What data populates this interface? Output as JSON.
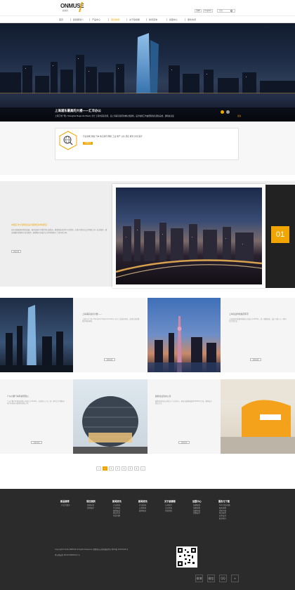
{
  "header": {
    "logo": "ONMUSE",
    "logo_sub": "欧穆斯",
    "lang_cn": "简体",
    "lang_en": "English",
    "search_placeholder": "搜索"
  },
  "nav": [
    "首页",
    "欧穆斯简介",
    "产品中心",
    "项目案例",
    "关于欧穆斯",
    "新闻咨询",
    "加盟中心",
    "服务支持"
  ],
  "nav_active_index": 3,
  "hero": {
    "title": "上海浦东最高的大楼——汇丰办公",
    "text": "上海汇丰广场 / Shanghai Magnolia Plaza | 位于上海市浦东新区，是上海浦东新区的地标性建筑，设计和施工均由国际知名团队完成，建筑总高度",
    "more": "更多"
  },
  "industry": {
    "text": "行业领域 金融 汽车 电子通讯 网络 工业 地产 公共 酒店 教育 文化 医疗",
    "button": "查看更多"
  },
  "feature": {
    "title": "中国汇丰大厦项目设计装修及材料研究",
    "desc": "近年来随着国内经济发展，国内高端写字楼需求日益增长，欧穆斯依托多年行业经验，为客户提供从设计到施工的一站式服务。通过精细化管理和专业化服务，欧穆斯在高端办公空间领域树立了良好的口碑。",
    "button": "查看详情",
    "number": "01"
  },
  "cards": [
    {
      "title": "上海浦东最高大楼——",
      "desc": "上海汇丰广场 | Shanghai Magnolia Plaza | 位于上海浦东新区，是浦东新区重要的地标建筑。",
      "button": "查看详情"
    },
    {
      "title": "上海创业科技集团写字",
      "desc": "上海创业科技集团有限公司成立于2003年，是一家集研发、设计与施工于一体的综合性企业。",
      "button": "查看详情"
    },
    {
      "title": "广州小鹏汽车科技有限公",
      "desc": "广州小鹏汽车科技有限公司成立于2014年，总部位于广州，是一家专注于智能电动汽车研发与制造的科技公司。",
      "button": "查看详情"
    },
    {
      "title": "越秀商业新办公室",
      "desc": "越秀商业新办公室位于广州市中心，项目总建筑面积约20000平方米，整体设计简洁大方。",
      "button": "查看详情"
    }
  ],
  "pagination": [
    "«",
    "1",
    "2",
    "3",
    "4",
    "5",
    "6",
    "»"
  ],
  "pagination_active": "1",
  "footer": {
    "columns": [
      {
        "title": "新品推荐",
        "items": [
          "产品专题页"
        ]
      },
      {
        "title": "项目案例",
        "items": [
          "案例分类",
          "案例展示"
        ]
      },
      {
        "title": "新闻资讯",
        "items": [
          "企业新闻",
          "行业动态",
          "媒体报道",
          "展会信息",
          "常见问题"
        ]
      },
      {
        "title": "新闻资讯",
        "items": [
          "行业新闻",
          "公司新闻",
          "媒体报道"
        ]
      },
      {
        "title": "关于欧穆斯",
        "items": [
          "公司简介",
          "企业文化",
          "荣誉资质"
        ]
      },
      {
        "title": "加盟中心",
        "items": [
          "加盟政策",
          "加盟流程",
          "加盟申请",
          "加盟支持"
        ]
      },
      {
        "title": "服务与下载",
        "items": [
          "FAQ 常见问题",
          "服务流程",
          "资料下载",
          "售后服务",
          "技术支持",
          "联系我们"
        ]
      }
    ],
    "copyright": "Copyright©2016 ONMUSE All Rights Reserved. 欧穆斯办公家具版权所有 粤ICP备 11001348 号",
    "icp": "粤公网安备 44011506002012 号",
    "social": [
      "微博",
      "微信",
      "QQ",
      "+"
    ]
  },
  "colors": {
    "accent": "#f0a500",
    "dark": "#222222",
    "footer": "#2b2b2b"
  }
}
